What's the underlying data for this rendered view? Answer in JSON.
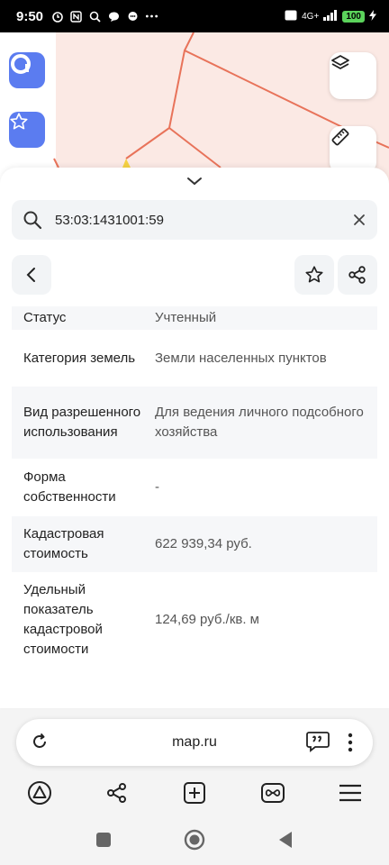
{
  "status_bar": {
    "time": "9:50",
    "battery": "100",
    "network": "4G+"
  },
  "search": {
    "query": "53:03:1431001:59"
  },
  "details": [
    {
      "key": "Статус",
      "value": "Учтенный"
    },
    {
      "key": "Категория земель",
      "value": "Земли населенных пунктов"
    },
    {
      "key": "Вид разрешенного использования",
      "value": "Для ведения личного подсобного хозяйства"
    },
    {
      "key": "Форма собственности",
      "value": "-"
    },
    {
      "key": "Кадастровая стоимость",
      "value": "622 939,34 руб."
    },
    {
      "key": "Удельный показатель кадастровой стоимости",
      "value": "124,69 руб./кв. м"
    }
  ],
  "browser": {
    "url": "map.ru"
  },
  "colors": {
    "accent": "#5b7cf0",
    "map_line": "#e8735a",
    "map_fill": "#fbe9e4"
  }
}
